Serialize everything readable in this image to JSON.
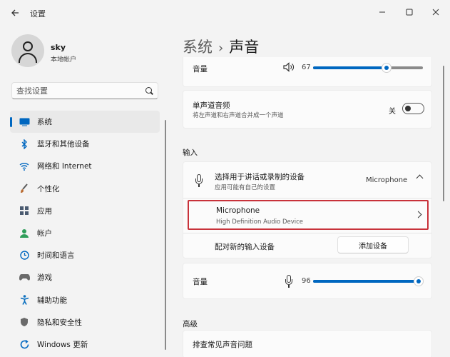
{
  "window": {
    "title": "设置"
  },
  "profile": {
    "name": "sky",
    "account": "本地帐户"
  },
  "search": {
    "placeholder": "查找设置"
  },
  "sidebar": {
    "items": [
      {
        "label": "系统",
        "icon": "monitor-icon",
        "color": "#0067c0",
        "active": true
      },
      {
        "label": "蓝牙和其他设备",
        "icon": "bluetooth-icon",
        "color": "#0067c0"
      },
      {
        "label": "网络和 Internet",
        "icon": "wifi-icon",
        "color": "#0067c0"
      },
      {
        "label": "个性化",
        "icon": "brush-icon",
        "color": "#b96b30"
      },
      {
        "label": "应用",
        "icon": "apps-icon",
        "color": "#4a5a70"
      },
      {
        "label": "帐户",
        "icon": "person-icon",
        "color": "#2f9e5a"
      },
      {
        "label": "时间和语言",
        "icon": "globe-clock-icon",
        "color": "#0067c0"
      },
      {
        "label": "游戏",
        "icon": "gamepad-icon",
        "color": "#6a6a6a"
      },
      {
        "label": "辅助功能",
        "icon": "accessibility-icon",
        "color": "#0a6fbf"
      },
      {
        "label": "隐私和安全性",
        "icon": "shield-icon",
        "color": "#6a6a6a"
      },
      {
        "label": "Windows 更新",
        "icon": "update-icon",
        "color": "#0067c0"
      }
    ]
  },
  "breadcrumb": {
    "parent": "系统",
    "separator": "›",
    "current": "声音"
  },
  "output": {
    "volume_label": "音量",
    "volume_value": "67",
    "volume_fraction": 0.67
  },
  "mono": {
    "label": "单声道音频",
    "description": "将左声道和右声道合并成一个声道",
    "toggle_state": "关"
  },
  "input": {
    "section_label": "输入",
    "choose_label": "选择用于讲话或录制的设备",
    "choose_description": "应用可能有自己的设置",
    "selected_device": "Microphone",
    "device": {
      "name": "Microphone",
      "description": "High Definition Audio Device"
    },
    "pair_label": "配对新的输入设备",
    "add_device_button": "添加设备",
    "volume_label": "音量",
    "volume_value": "96",
    "volume_fraction": 0.96
  },
  "advanced": {
    "section_label": "高级",
    "troubleshoot_label": "排查常见声音问题"
  },
  "colors": {
    "accent": "#0067c0",
    "highlight_border": "#c8323a"
  }
}
